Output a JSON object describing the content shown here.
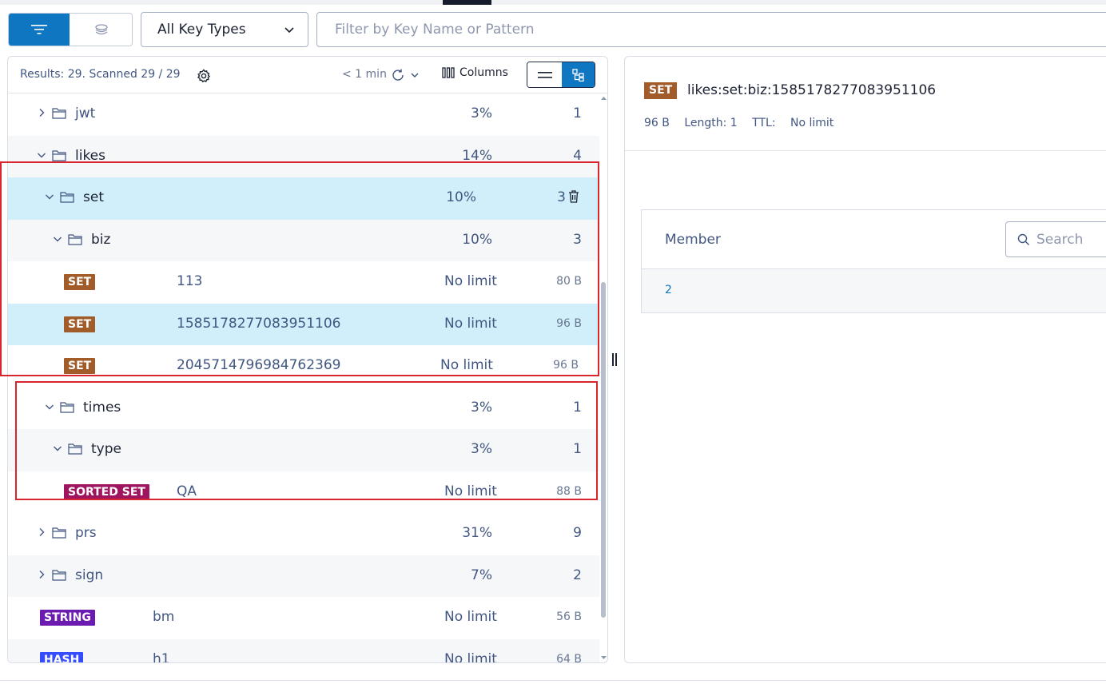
{
  "toolbar": {
    "key_type_select": "All Key Types",
    "filter_placeholder": "Filter by Key Name or Pattern"
  },
  "browser": {
    "results_label": "Results: 29.",
    "scanned_label": "Scanned 29 / 29",
    "last_refresh": "< 1 min",
    "columns_label": "Columns"
  },
  "tree_rows": [
    {
      "kind": "folder",
      "name": "jwt",
      "expanded": false,
      "percent": "3%",
      "count": "1"
    },
    {
      "kind": "folder",
      "name": "likes",
      "expanded": true,
      "percent": "14%",
      "count": "4"
    },
    {
      "kind": "folder",
      "name": "set",
      "expanded": true,
      "percent": "10%",
      "count": "3"
    },
    {
      "kind": "folder",
      "name": "biz",
      "expanded": true,
      "percent": "10%",
      "count": "3"
    },
    {
      "kind": "key",
      "type": "SET",
      "name": "113",
      "ttl": "No limit",
      "size": "80 B"
    },
    {
      "kind": "key",
      "type": "SET",
      "name": "1585178277083951106",
      "ttl": "No limit",
      "size": "96 B"
    },
    {
      "kind": "key",
      "type": "SET",
      "name": "2045714796984762369",
      "ttl": "No limit",
      "size": "96 B"
    },
    {
      "kind": "folder",
      "name": "times",
      "expanded": true,
      "percent": "3%",
      "count": "1"
    },
    {
      "kind": "folder",
      "name": "type",
      "expanded": true,
      "percent": "3%",
      "count": "1"
    },
    {
      "kind": "key",
      "type": "SORTED SET",
      "name": "QA",
      "ttl": "No limit",
      "size": "88 B"
    },
    {
      "kind": "folder",
      "name": "prs",
      "expanded": false,
      "percent": "31%",
      "count": "9"
    },
    {
      "kind": "folder",
      "name": "sign",
      "expanded": false,
      "percent": "7%",
      "count": "2"
    },
    {
      "kind": "key",
      "type": "STRING",
      "name": "bm",
      "ttl": "No limit",
      "size": "56 B"
    },
    {
      "kind": "key",
      "type": "HASH",
      "name": "h1",
      "ttl": "No limit",
      "size": "64 B"
    }
  ],
  "details": {
    "type": "SET",
    "key_name": "likes:set:biz:1585178277083951106",
    "size": "96 B",
    "length": "Length: 1",
    "ttl_label": "TTL:",
    "ttl_value": "No limit",
    "column_header": "Member",
    "search_placeholder": "Search",
    "members": [
      "2"
    ]
  },
  "colors": {
    "accent": "#0f76c2",
    "set": "#a15c2a",
    "sorted_set": "#a0155f",
    "string": "#6c1bb1",
    "hash": "#364cff",
    "selected_row": "#d1effb",
    "highlight_box": "#d9252d"
  }
}
